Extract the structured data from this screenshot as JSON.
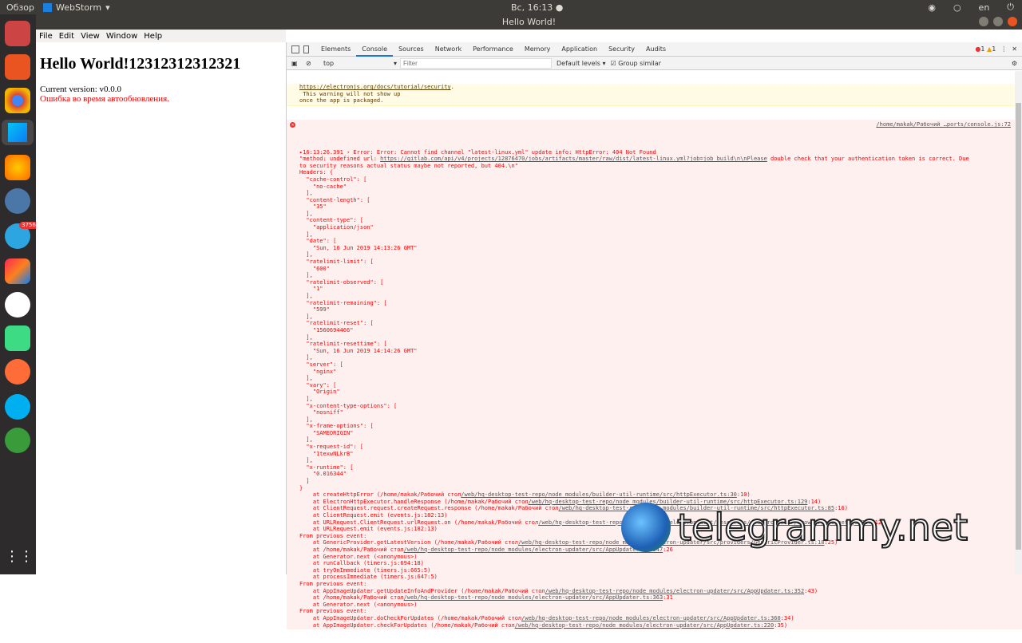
{
  "topbar": {
    "overview": "Обзор",
    "app": "WebStorm",
    "clock": "Вс, 16:13 ●",
    "lang": "en"
  },
  "window": {
    "title": "Hello World!"
  },
  "dock": {
    "telegram_badge": "3756"
  },
  "menu": [
    "File",
    "Edit",
    "View",
    "Window",
    "Help"
  ],
  "page": {
    "heading": "Hello World!12312312312321",
    "version": "Current version: v0.0.0",
    "error": "Ошибка во время автообновления."
  },
  "devtools": {
    "tabs": [
      "Elements",
      "Console",
      "Sources",
      "Network",
      "Performance",
      "Memory",
      "Application",
      "Security",
      "Audits"
    ],
    "active_tab": "Console",
    "errors": "1",
    "warnings": "1",
    "context": "top",
    "filter_placeholder": "Filter",
    "levels": "Default levels ▾",
    "group_similar": "Group similar",
    "warning_lines": [
      [
        [
          "https://electronjs.org/docs/tutorial/security",
          "l"
        ],
        [
          ".",
          ""
        ]
      ],
      [
        [
          " This warning will not show up",
          ""
        ]
      ],
      [
        [
          "once the app is packaged.",
          ""
        ]
      ]
    ],
    "error_source": "/home/makak/Рабочий …ports/console.js:72",
    "error_lines": [
      [
        [
          "▸16:13:26.391 › Error: Error: Cannot find channel \"latest-linux.yml\" update info: HttpError: 404 Not Found",
          ""
        ]
      ],
      [
        [
          "\"method: undefined url: ",
          ""
        ],
        [
          "https://gitlab.com/api/v4/projects/12876470/jobs/artifacts/master/raw/dist/latest-linux.yml?job=job_build\\n\\nPlease",
          "l"
        ],
        [
          " double check that your authentication token is correct. Due",
          ""
        ]
      ],
      [
        [
          "to security reasons actual status maybe not reported, but 404.\\n\"",
          ""
        ]
      ],
      [
        [
          "Headers: {",
          ""
        ]
      ],
      [
        [
          "  \"cache-control\": [",
          ""
        ]
      ],
      [
        [
          "    \"no-cache\"",
          ""
        ]
      ],
      [
        [
          "  ],",
          ""
        ]
      ],
      [
        [
          "  \"content-length\": [",
          ""
        ]
      ],
      [
        [
          "    \"35\"",
          ""
        ]
      ],
      [
        [
          "  ],",
          ""
        ]
      ],
      [
        [
          "  \"content-type\": [",
          ""
        ]
      ],
      [
        [
          "    \"application/json\"",
          ""
        ]
      ],
      [
        [
          "  ],",
          ""
        ]
      ],
      [
        [
          "  \"date\": [",
          ""
        ]
      ],
      [
        [
          "    \"Sun, 16 Jun 2019 14:13:26 GMT\"",
          ""
        ]
      ],
      [
        [
          "  ],",
          ""
        ]
      ],
      [
        [
          "  \"ratelimit-limit\": [",
          ""
        ]
      ],
      [
        [
          "    \"600\"",
          ""
        ]
      ],
      [
        [
          "  ],",
          ""
        ]
      ],
      [
        [
          "  \"ratelimit-observed\": [",
          ""
        ]
      ],
      [
        [
          "    \"1\"",
          ""
        ]
      ],
      [
        [
          "  ],",
          ""
        ]
      ],
      [
        [
          "  \"ratelimit-remaining\": [",
          ""
        ]
      ],
      [
        [
          "    \"599\"",
          ""
        ]
      ],
      [
        [
          "  ],",
          ""
        ]
      ],
      [
        [
          "  \"ratelimit-reset\": [",
          ""
        ]
      ],
      [
        [
          "    \"1560694466\"",
          ""
        ]
      ],
      [
        [
          "  ],",
          ""
        ]
      ],
      [
        [
          "  \"ratelimit-resettime\": [",
          ""
        ]
      ],
      [
        [
          "    \"Sun, 16 Jun 2019 14:14:26 GMT\"",
          ""
        ]
      ],
      [
        [
          "  ],",
          ""
        ]
      ],
      [
        [
          "  \"server\": [",
          ""
        ]
      ],
      [
        [
          "    \"nginx\"",
          ""
        ]
      ],
      [
        [
          "  ],",
          ""
        ]
      ],
      [
        [
          "  \"vary\": [",
          ""
        ]
      ],
      [
        [
          "    \"Origin\"",
          ""
        ]
      ],
      [
        [
          "  ],",
          ""
        ]
      ],
      [
        [
          "  \"x-content-type-options\": [",
          ""
        ]
      ],
      [
        [
          "    \"nosniff\"",
          ""
        ]
      ],
      [
        [
          "  ],",
          ""
        ]
      ],
      [
        [
          "  \"x-frame-options\": [",
          ""
        ]
      ],
      [
        [
          "    \"SAMEORIGIN\"",
          ""
        ]
      ],
      [
        [
          "  ],",
          ""
        ]
      ],
      [
        [
          "  \"x-request-id\": [",
          ""
        ]
      ],
      [
        [
          "    \"1texwNLkrB\"",
          ""
        ]
      ],
      [
        [
          "  ],",
          ""
        ]
      ],
      [
        [
          "  \"x-runtime\": [",
          ""
        ]
      ],
      [
        [
          "    \"0.016344\"",
          ""
        ]
      ],
      [
        [
          "  ]",
          ""
        ]
      ],
      [
        [
          "}",
          ""
        ]
      ],
      [
        [
          "    at createHttpError (/home/makak/Рабочий стол",
          ""
        ],
        [
          "/web/hq-desktop-test-repo/node_modules/builder-util-runtime/src/httpExecutor.ts:30",
          "l"
        ],
        [
          ":10)",
          ""
        ]
      ],
      [
        [
          "    at ElectronHttpExecutor.handleResponse (/home/makak/Рабочий стол",
          ""
        ],
        [
          "/web/hq-desktop-test-repo/node_modules/builder-util-runtime/src/httpExecutor.ts:129",
          "l"
        ],
        [
          ":14)",
          ""
        ]
      ],
      [
        [
          "    at ClientRequest.request.createRequest.response (/home/makak/Рабочий стол",
          ""
        ],
        [
          "/web/hq-desktop-test-repo/node_modules/builder-util-runtime/src/httpExecutor.ts:85",
          "l"
        ],
        [
          ":16)",
          ""
        ]
      ],
      [
        [
          "    at ClientRequest.emit (events.js:182:13)",
          ""
        ]
      ],
      [
        [
          "    at URLRequest.ClientRequest.urlRequest.on (/home/makak/Рабочий стол",
          ""
        ],
        [
          "/web/hq-desktop-test-repo/node_modules/electron/dist/resources/electron.asar/browser/api/net.js:207",
          "l"
        ],
        [
          ":12)",
          ""
        ]
      ],
      [
        [
          "    at URLRequest.emit (events.js:182:13)",
          ""
        ]
      ],
      [
        [
          "From previous event:",
          ""
        ]
      ],
      [
        [
          "    at GenericProvider.getLatestVersion (/home/makak/Рабочий стол",
          ""
        ],
        [
          "/web/hq-desktop-test-repo/node_modules/electron-updater/src/providers/GenericProvider.ts:18",
          "l"
        ],
        [
          ":25)",
          ""
        ]
      ],
      [
        [
          "    at /home/makak/Рабочий стол",
          ""
        ],
        [
          "/web/hq-desktop-test-repo/node_modules/electron-updater/src/AppUpdater.ts:347",
          "l"
        ],
        [
          ":26",
          ""
        ]
      ],
      [
        [
          "    at Generator.next (<anonymous>)",
          ""
        ]
      ],
      [
        [
          "    at runCallback (timers.js:694:18)",
          ""
        ]
      ],
      [
        [
          "    at tryOnImmediate (timers.js:665:5)",
          ""
        ]
      ],
      [
        [
          "    at processImmediate (timers.js:647:5)",
          ""
        ]
      ],
      [
        [
          "From previous event:",
          ""
        ]
      ],
      [
        [
          "    at AppImageUpdater.getUpdateInfoAndProvider (/home/makak/Рабочий стол",
          ""
        ],
        [
          "/web/hq-desktop-test-repo/node_modules/electron-updater/src/AppUpdater.ts:352",
          "l"
        ],
        [
          ":43)",
          ""
        ]
      ],
      [
        [
          "    at /home/makak/Рабочий стол",
          ""
        ],
        [
          "/web/hq-desktop-test-repo/node_modules/electron-updater/src/AppUpdater.ts:363",
          "l"
        ],
        [
          ":31",
          ""
        ]
      ],
      [
        [
          "    at Generator.next (<anonymous>)",
          ""
        ]
      ],
      [
        [
          "From previous event:",
          ""
        ]
      ],
      [
        [
          "    at AppImageUpdater.doCheckForUpdates (/home/makak/Рабочий стол",
          ""
        ],
        [
          "/web/hq-desktop-test-repo/node_modules/electron-updater/src/AppUpdater.ts:360",
          "l"
        ],
        [
          ":34)",
          ""
        ]
      ],
      [
        [
          "    at AppImageUpdater.checkForUpdates (/home/makak/Рабочий стол",
          ""
        ],
        [
          "/web/hq-desktop-test-repo/node_modules/electron-updater/src/AppUpdater.ts:220",
          "l"
        ],
        [
          ":35)",
          ""
        ]
      ]
    ]
  },
  "watermark": "telegrammy.net"
}
